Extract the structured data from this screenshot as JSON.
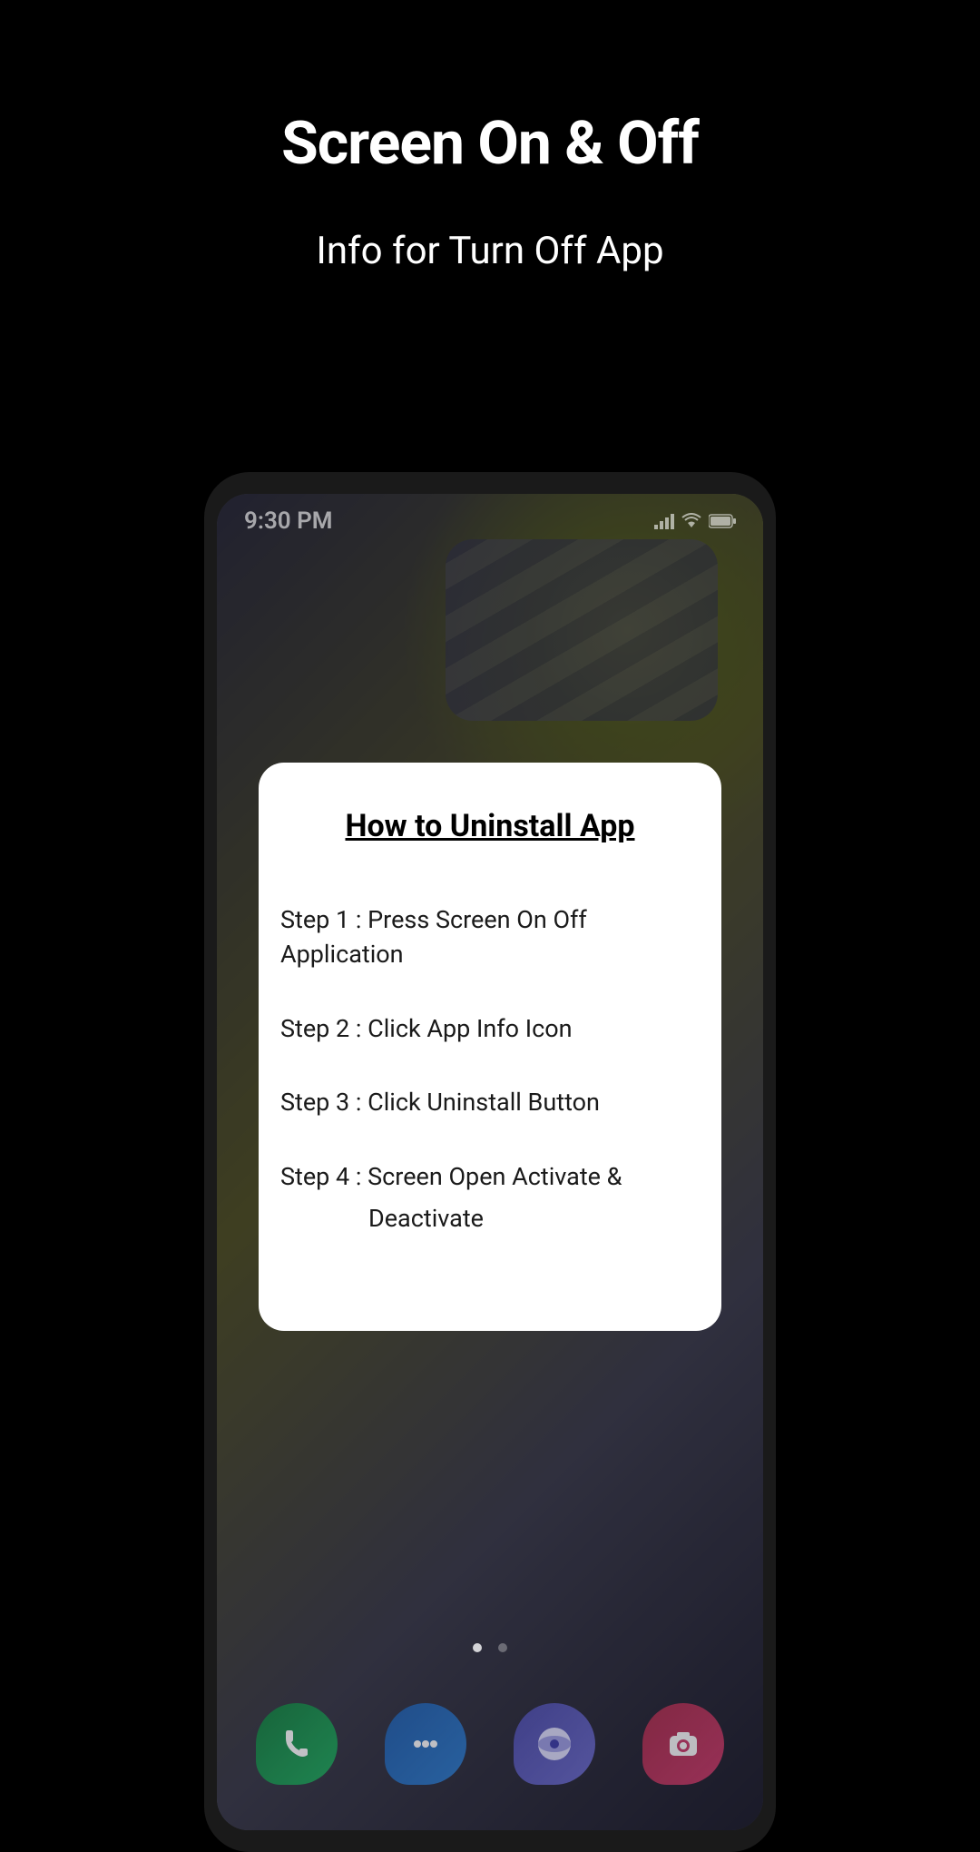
{
  "header": {
    "title": "Screen On & Off",
    "subtitle": "Info for Turn Off App"
  },
  "phone": {
    "status_bar": {
      "time": "9:30 PM"
    },
    "dialog": {
      "title": "How to Uninstall App",
      "steps": [
        "Step 1 : Press Screen On Off Application",
        "Step 2 : Click App Info Icon",
        "Step 3 : Click Uninstall Button",
        "Step 4 : Screen Open Activate &",
        "Deactivate"
      ]
    },
    "page_indicator": {
      "current": 1,
      "total": 2
    },
    "dock": {
      "icons": [
        "phone",
        "messages",
        "browser",
        "camera"
      ]
    }
  }
}
